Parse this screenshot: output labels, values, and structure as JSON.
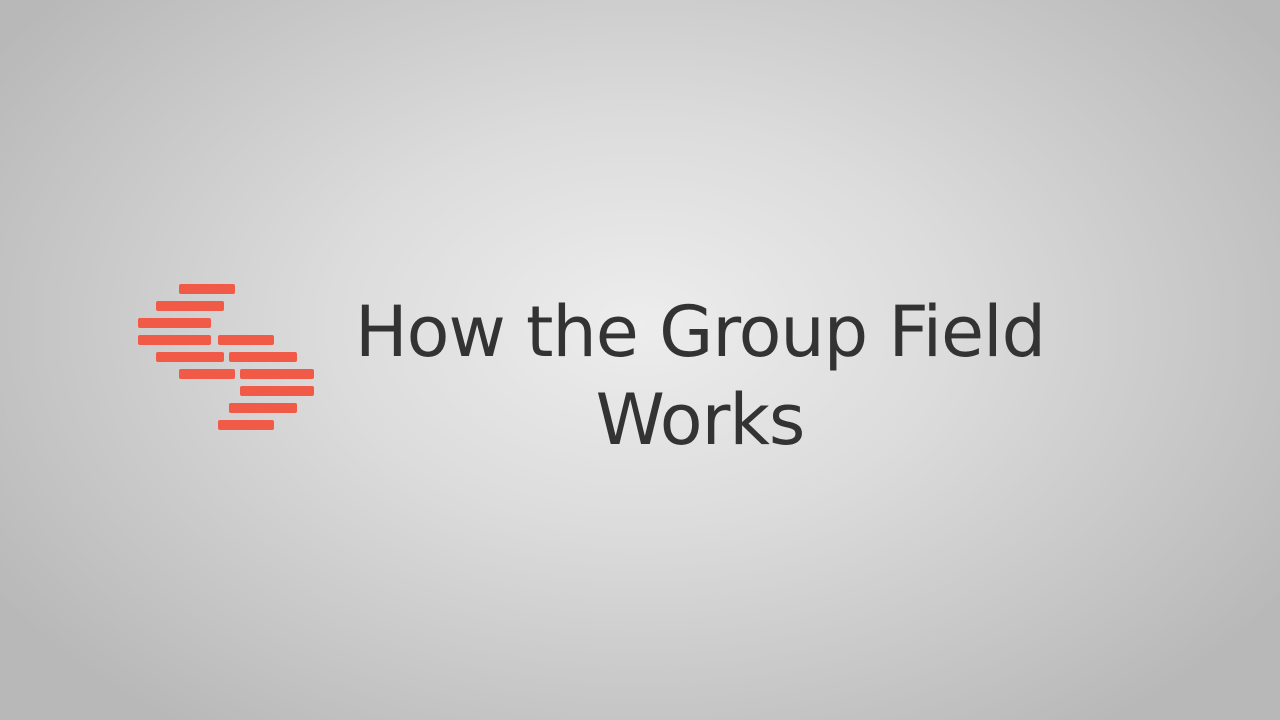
{
  "brand": {
    "logo_icon": "stacked-bars-logo-icon",
    "logo_color": "#f05a47"
  },
  "slide": {
    "title_line_1": "How the Group Field",
    "title_line_2": "Works",
    "title_color": "#333333"
  }
}
